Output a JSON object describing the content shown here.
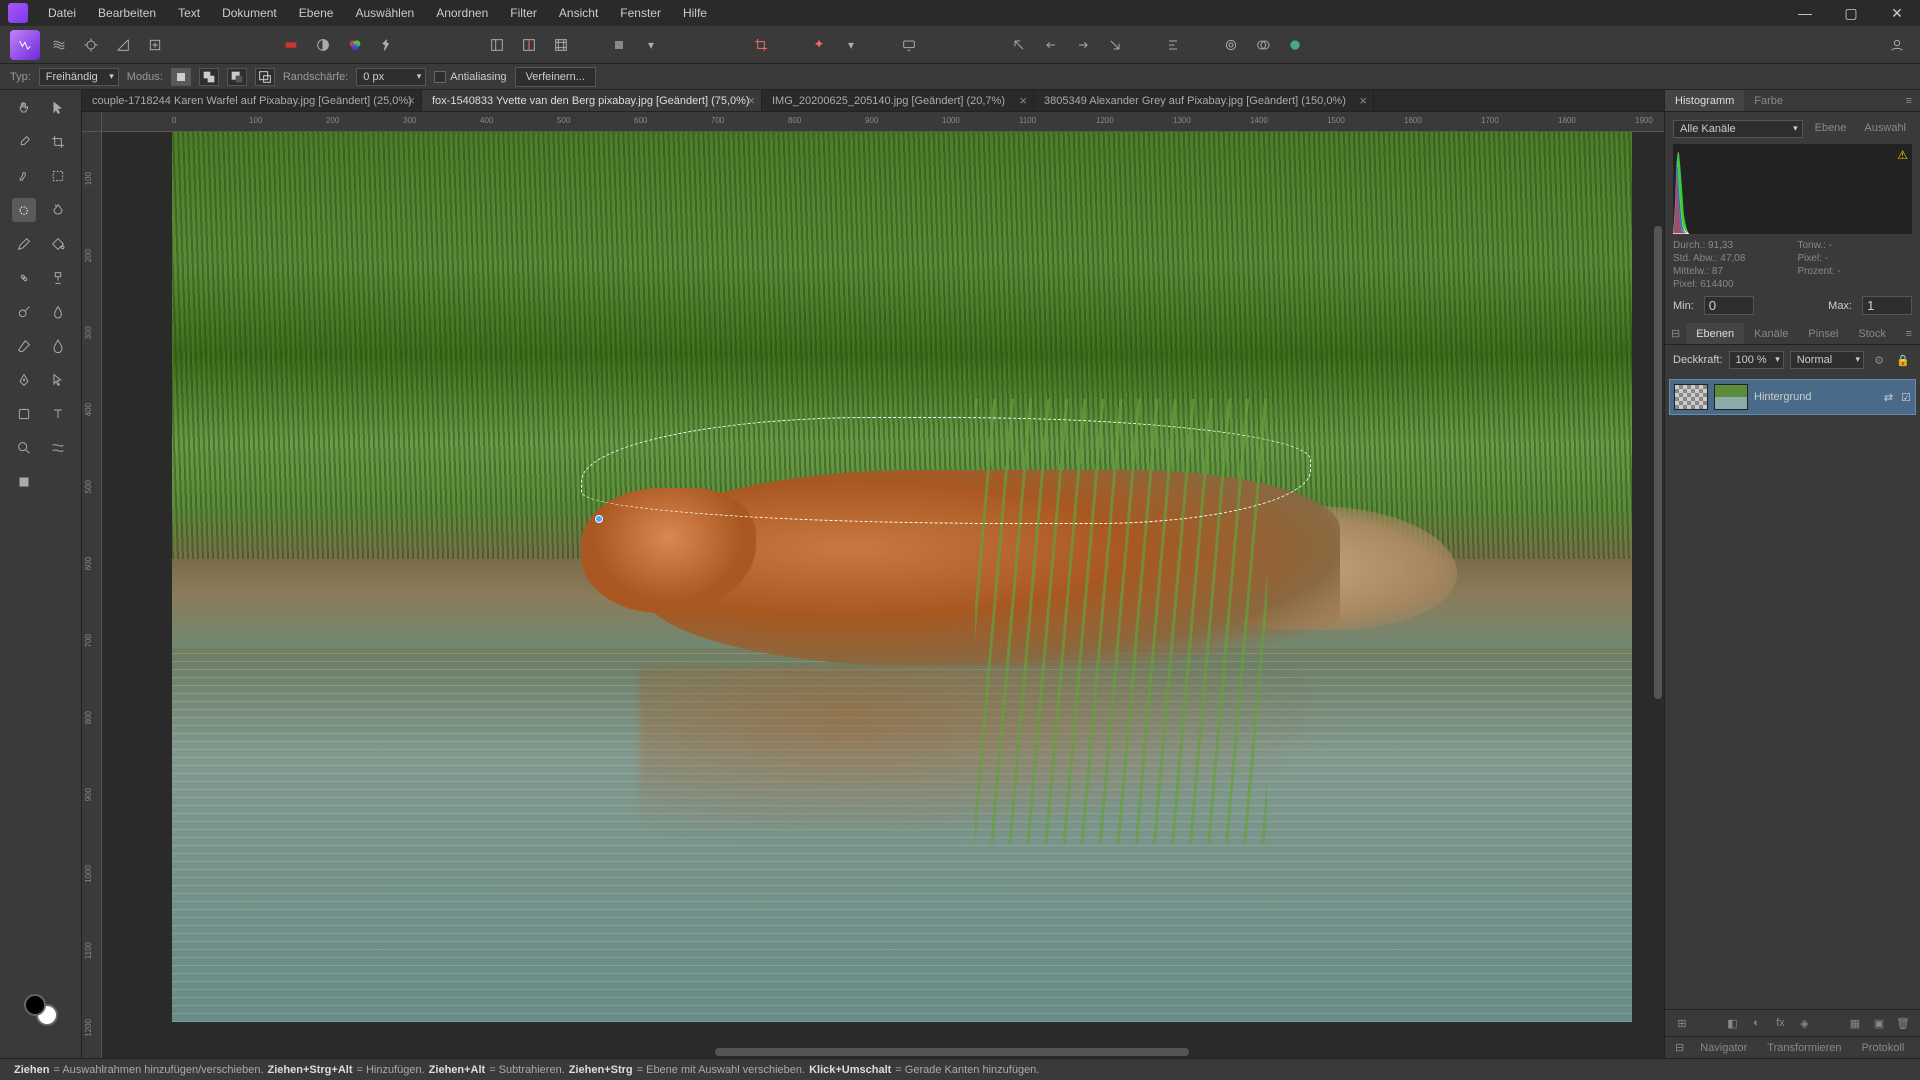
{
  "menu": [
    "Datei",
    "Bearbeiten",
    "Text",
    "Dokument",
    "Ebene",
    "Auswählen",
    "Anordnen",
    "Filter",
    "Ansicht",
    "Fenster",
    "Hilfe"
  ],
  "context": {
    "type_label": "Typ:",
    "type_value": "Freihändig",
    "mode_label": "Modus:",
    "feather_label": "Randschärfe:",
    "feather_value": "0 px",
    "antialias": "Antialiasing",
    "refine": "Verfeinern..."
  },
  "tabs": [
    {
      "title": "couple-1718244 Karen Warfel auf Pixabay.jpg [Geändert] (25,0%)",
      "active": false
    },
    {
      "title": "fox-1540833 Yvette van den Berg pixabay.jpg [Geändert] (75,0%)",
      "active": true
    },
    {
      "title": "IMG_20200625_205140.jpg [Geändert] (20,7%)",
      "active": false
    },
    {
      "title": "3805349 Alexander Grey auf Pixabay.jpg [Geändert] (150,0%)",
      "active": false
    }
  ],
  "ruler_h": [
    "0",
    "100",
    "200",
    "300",
    "400",
    "500",
    "600",
    "700",
    "800",
    "900",
    "1000",
    "1100",
    "1200",
    "1300",
    "1400",
    "1500",
    "1600",
    "1700",
    "1800",
    "1900"
  ],
  "ruler_v": [
    "100",
    "200",
    "300",
    "400",
    "500",
    "600",
    "700",
    "800",
    "900",
    "1000",
    "1100",
    "1200"
  ],
  "right": {
    "hist_tabs": [
      "Histogramm",
      "Farbe"
    ],
    "channels": "Alle Kanäle",
    "hist_mode": [
      "Ebene",
      "Auswahl"
    ],
    "stats": {
      "mean_l": "Durch.:",
      "mean_v": "91,33",
      "sd_l": "Std. Abw.:",
      "sd_v": "47,08",
      "med_l": "Mittelw.:",
      "med_v": "87",
      "px_l": "Pixel:",
      "px_v": "614400",
      "tone_l": "Tonw.:",
      "tone_v": "-",
      "pxr_l": "Pixel:",
      "pxr_v": "-",
      "pct_l": "Prozent:",
      "pct_v": "-"
    },
    "min_l": "Min:",
    "min_v": "0",
    "max_l": "Max:",
    "max_v": "1",
    "layer_tabs": [
      "Ebenen",
      "Kanäle",
      "Pinsel",
      "Stock"
    ],
    "opacity_l": "Deckkraft:",
    "opacity_v": "100 %",
    "blend": "Normal",
    "layer_name": "Hintergrund",
    "bottom_tabs": [
      "Navigator",
      "Transformieren",
      "Protokoll"
    ]
  },
  "status": {
    "s1": "Ziehen",
    "s1t": " = Auswahlrahmen hinzufügen/verschieben. ",
    "s2": "Ziehen+Strg+Alt",
    "s2t": " = Hinzufügen. ",
    "s3": "Ziehen+Alt",
    "s3t": " = Subtrahieren. ",
    "s4": "Ziehen+Strg",
    "s4t": " = Ebene mit Auswahl verschieben. ",
    "s5": "Klick+Umschalt",
    "s5t": " = Gerade Kanten hinzufügen."
  }
}
